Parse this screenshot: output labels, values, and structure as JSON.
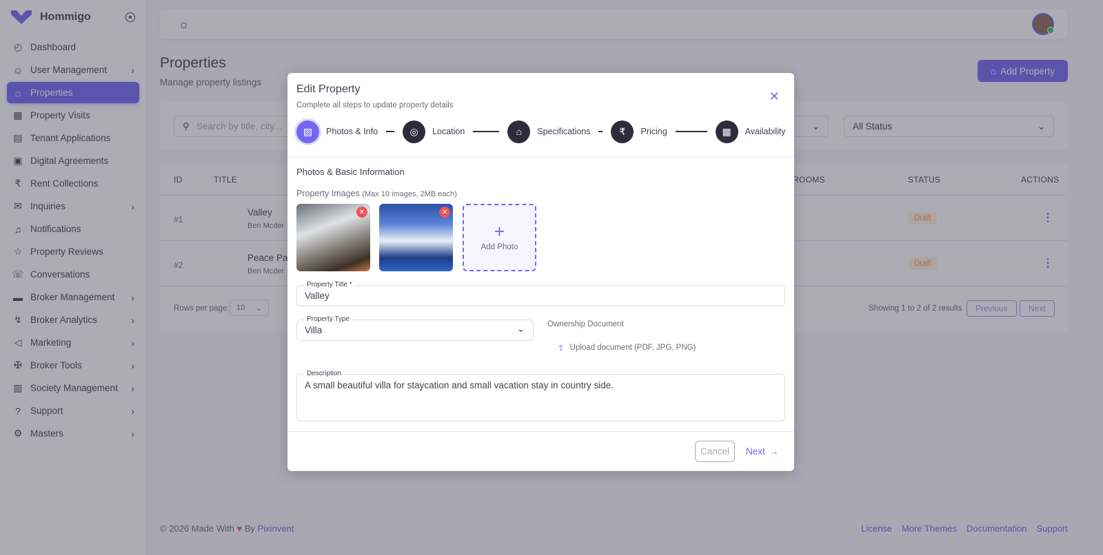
{
  "brand": {
    "name": "Hommigo"
  },
  "sidebar": {
    "items": [
      {
        "label": "Dashboard",
        "icon": "gauge-icon",
        "chev": false
      },
      {
        "label": "User Management",
        "icon": "users-icon",
        "chev": true
      },
      {
        "label": "Properties",
        "icon": "home-icon",
        "chev": false,
        "active": true
      },
      {
        "label": "Property Visits",
        "icon": "calendar-icon",
        "chev": false
      },
      {
        "label": "Tenant Applications",
        "icon": "file-icon",
        "chev": false
      },
      {
        "label": "Digital Agreements",
        "icon": "file-signature-icon",
        "chev": false
      },
      {
        "label": "Rent Collections",
        "icon": "rupee-icon",
        "chev": false
      },
      {
        "label": "Inquiries",
        "icon": "message-icon",
        "chev": true
      },
      {
        "label": "Notifications",
        "icon": "bell-icon",
        "chev": false
      },
      {
        "label": "Property Reviews",
        "icon": "star-icon",
        "chev": false
      },
      {
        "label": "Conversations",
        "icon": "chat-icon",
        "chev": false
      },
      {
        "label": "Broker Management",
        "icon": "briefcase-icon",
        "chev": true
      },
      {
        "label": "Broker Analytics",
        "icon": "chart-icon",
        "chev": true
      },
      {
        "label": "Marketing",
        "icon": "megaphone-icon",
        "chev": true
      },
      {
        "label": "Broker Tools",
        "icon": "tools-icon",
        "chev": true
      },
      {
        "label": "Society Management",
        "icon": "building-icon",
        "chev": true
      },
      {
        "label": "Support",
        "icon": "help-icon",
        "chev": true
      },
      {
        "label": "Masters",
        "icon": "settings-icon",
        "chev": true
      }
    ]
  },
  "page": {
    "title": "Properties",
    "subtitle": "Manage property listings",
    "add_button": "Add Property"
  },
  "filters": {
    "search_placeholder": "Search by title, city...",
    "status": "All Status"
  },
  "table": {
    "headers": {
      "id": "ID",
      "title": "TITLE",
      "rooms": "ROOMS",
      "status": "STATUS",
      "actions": "ACTIONS"
    },
    "rows": [
      {
        "id": "#1",
        "title": "Valley",
        "owner": "Ben Mcder",
        "status": "Draft"
      },
      {
        "id": "#2",
        "title": "Peace Par",
        "owner": "Ben Mcder",
        "status": "Draft"
      }
    ],
    "rows_per_page_label": "Rows per page:",
    "rows_per_page": "10",
    "showing": "Showing 1 to 2 of 2 results",
    "previous": "Previous",
    "next": "Next"
  },
  "footer": {
    "copy": "© 2026 Made With",
    "by": "By",
    "author": "Pixinvent",
    "links": [
      "License",
      "More Themes",
      "Documentation",
      "Support"
    ]
  },
  "modal": {
    "title": "Edit Property",
    "subtitle": "Complete all steps to update property details",
    "steps": [
      {
        "label": "Photos & Info",
        "icon": "image-icon"
      },
      {
        "label": "Location",
        "icon": "map-pin-icon"
      },
      {
        "label": "Specifications",
        "icon": "home-icon"
      },
      {
        "label": "Pricing",
        "icon": "rupee-icon"
      },
      {
        "label": "Availability",
        "icon": "calendar-icon"
      }
    ],
    "section": "Photos & Basic Information",
    "images_label": "Property Images",
    "images_hint": "(Max 10 images, 2MB each)",
    "add_photo": "Add Photo",
    "title_label": "Property Title *",
    "title_value": "Valley",
    "type_label": "Property Type",
    "type_value": "Villa",
    "ownership_label": "Ownership Document",
    "upload_label": "Upload document (PDF, JPG, PNG)",
    "description_label": "Description",
    "description_value": "A small beautiful villa for staycation and small vacation stay in country side.",
    "cancel": "Cancel",
    "next": "Next"
  },
  "colors": {
    "primary": "#7367f0",
    "danger": "#ea5455",
    "warning": "#ff9f43"
  }
}
